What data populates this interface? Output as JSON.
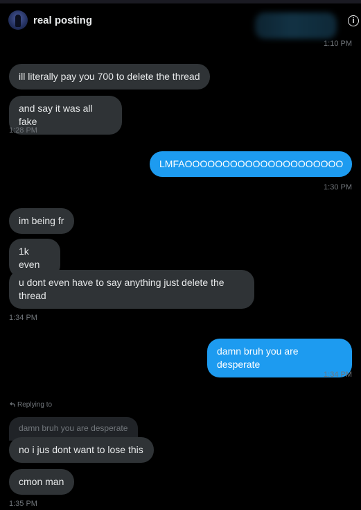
{
  "header": {
    "title": "real posting",
    "info_label": "i"
  },
  "messages": [
    {
      "text": "",
      "time": "1:10 PM"
    },
    {
      "text": "ill literally pay you 700 to delete the thread"
    },
    {
      "text": "and say it was all fake",
      "time": "1:28 PM"
    },
    {
      "text": "LMFAOOOOOOOOOOOOOOOOOOOOO",
      "time": "1:30 PM"
    },
    {
      "text": "im being fr"
    },
    {
      "text": "1k even"
    },
    {
      "text": "u dont even have to say anything just delete the thread",
      "time": "1:34 PM"
    },
    {
      "text": "damn bruh you are desperate",
      "time": "1:34 PM"
    },
    {
      "text": "no i jus dont want to lose this"
    },
    {
      "text": "cmon man",
      "time": "1:35 PM"
    }
  ],
  "reply": {
    "label": "Replying to",
    "quoted_text": "damn bruh you are desperate"
  },
  "colors": {
    "background": "#000000",
    "incoming_bubble": "#2f3336",
    "outgoing_bubble": "#1d9bf0",
    "timestamp": "#71767b"
  }
}
